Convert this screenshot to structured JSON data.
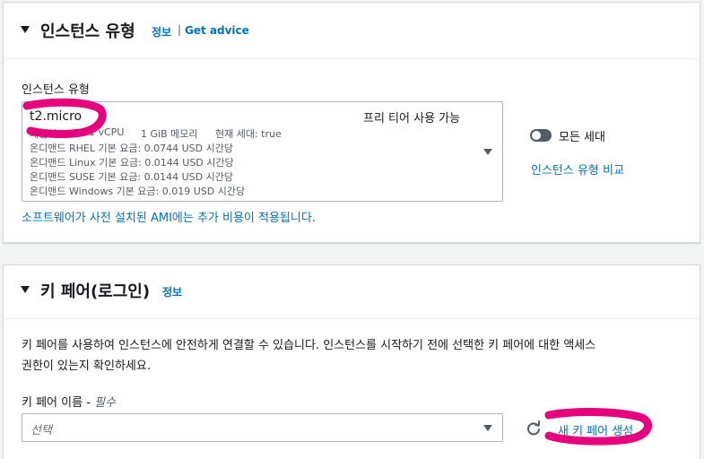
{
  "instance_section": {
    "title": "인스턴스 유형",
    "info_link": "정보",
    "separator": "|",
    "advice_link": "Get advice",
    "field_label": "인스턴스 유형",
    "selected": {
      "name": "t2.micro",
      "free_tier": "프리 티어 사용 가능",
      "family": "패밀리: t2",
      "vcpu": "1 vCPU",
      "memory": "1 GiB 메모리",
      "generation": "현재 세대: true",
      "pricing": [
        "온디맨드 RHEL 기본 요금: 0.0744 USD 시간당",
        "온디맨드 Linux 기본 요금: 0.0144 USD 시간당",
        "온디맨드 SUSE 기본 요금: 0.0144 USD 시간당",
        "온디맨드 Windows 기본 요금: 0.019 USD 시간당"
      ]
    },
    "toggle_label": "모든 세대",
    "compare_link": "인스턴스 유형 비교",
    "ami_note": "소프트웨어가 사전 설치된 AMI에는 추가 비용이 적용됩니다."
  },
  "keypair_section": {
    "title": "키 페어(로그인)",
    "info_link": "정보",
    "description_line1": "키 페어를 사용하여 인스턴스에 안전하게 연결할 수 있습니다. 인스턴스를 시작하기 전에 선택한 키 페어에 대한 액세스",
    "description_line2": "권한이 있는지 확인하세요.",
    "field_label": "키 페어 이름 - ",
    "required": "필수",
    "placeholder": "선택",
    "create_link": "새 키 페어 생성"
  },
  "colors": {
    "link": "#0073bb",
    "highlight": "#e6007e"
  }
}
